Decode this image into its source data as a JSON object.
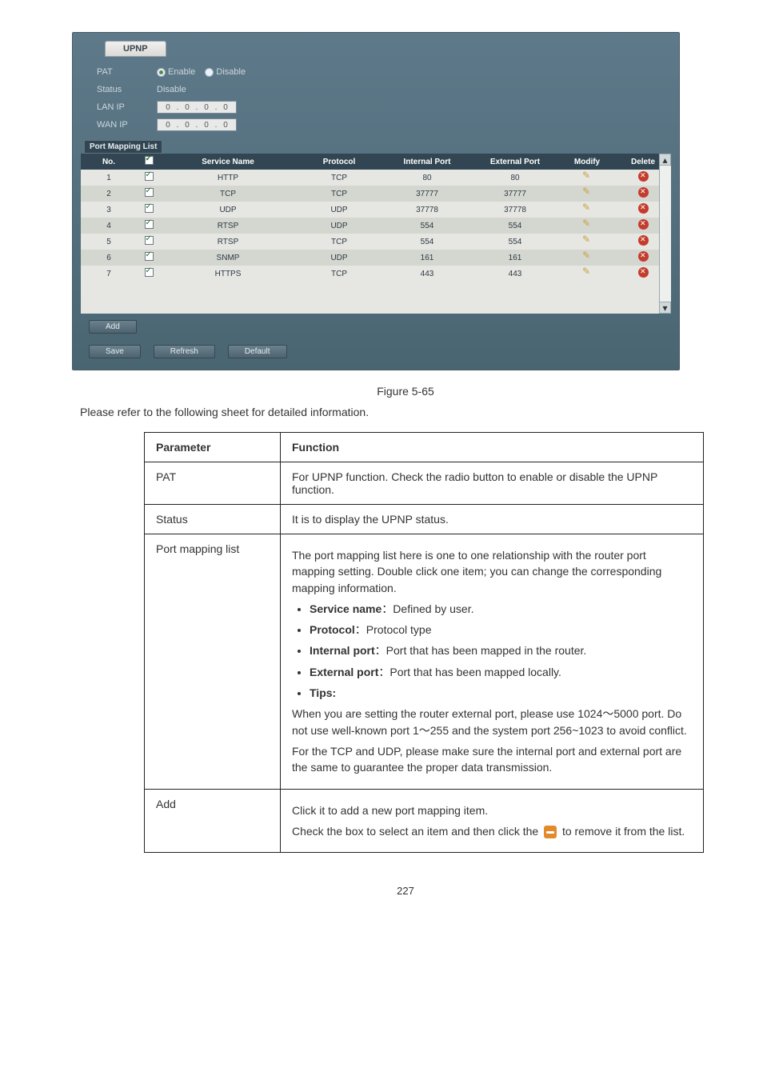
{
  "screenshot": {
    "tab": "UPNP",
    "rows": {
      "pat": {
        "label": "PAT",
        "enable": "Enable",
        "disable": "Disable",
        "checked": "enable"
      },
      "status": {
        "label": "Status",
        "value": "Disable"
      },
      "lanip": {
        "label": "LAN IP",
        "ip": [
          "0",
          "0",
          "0",
          "0"
        ]
      },
      "wanip": {
        "label": "WAN IP",
        "ip": [
          "0",
          "0",
          "0",
          "0"
        ]
      }
    },
    "subtab": "Port Mapping List",
    "grid": {
      "headers": {
        "no": "No.",
        "chk": "",
        "svc": "Service Name",
        "proto": "Protocol",
        "ip": "Internal Port",
        "ep": "External Port",
        "mod": "Modify",
        "del": "Delete"
      },
      "rows": [
        {
          "no": "1",
          "svc": "HTTP",
          "proto": "TCP",
          "ip": "80",
          "ep": "80"
        },
        {
          "no": "2",
          "svc": "TCP",
          "proto": "TCP",
          "ip": "37777",
          "ep": "37777"
        },
        {
          "no": "3",
          "svc": "UDP",
          "proto": "UDP",
          "ip": "37778",
          "ep": "37778"
        },
        {
          "no": "4",
          "svc": "RTSP",
          "proto": "UDP",
          "ip": "554",
          "ep": "554"
        },
        {
          "no": "5",
          "svc": "RTSP",
          "proto": "TCP",
          "ip": "554",
          "ep": "554"
        },
        {
          "no": "6",
          "svc": "SNMP",
          "proto": "UDP",
          "ip": "161",
          "ep": "161"
        },
        {
          "no": "7",
          "svc": "HTTPS",
          "proto": "TCP",
          "ip": "443",
          "ep": "443"
        }
      ]
    },
    "buttons": {
      "add": "Add",
      "save": "Save",
      "refresh": "Refresh",
      "default": "Default"
    }
  },
  "caption": "Figure 5-65",
  "para": "Please refer to the following sheet for detailed information.",
  "params": {
    "head": {
      "p": "Parameter",
      "f": "Function"
    },
    "rows": [
      {
        "p": "PAT",
        "f": "For UPNP function. Check the radio button to enable or disable the UPNP function."
      },
      {
        "p": "Status",
        "f": "It is to display the UPNP status."
      }
    ],
    "pml": {
      "p": "Port mapping list",
      "intro": "The port mapping list here is one to one relationship with the router port mapping setting. Double click one item; you can change the corresponding mapping information.",
      "items": [
        {
          "b": "Service name",
          "t": "Defined by user."
        },
        {
          "b": "Protocol",
          "t": "Protocol type"
        },
        {
          "b": "Internal port",
          "t": "Port that has been mapped in the router."
        },
        {
          "b": "External port",
          "t": "Port that has been mapped locally."
        }
      ],
      "tips_label": "Tips:",
      "tips1": "When you are setting the router external port, please use 1024～5000 port. Do not use well-known port 1～255 and the system port 256~1023 to avoid conflict.",
      "tips2": "For the TCP and UDP, please make sure the internal port and external port are the same to guarantee the proper data transmission."
    },
    "add": {
      "p": "Add",
      "f1": "Click it to add a new port mapping item.",
      "f2": "Check the box to select an item and then click the ",
      "f3": " to remove it from the list."
    }
  },
  "page": "227"
}
